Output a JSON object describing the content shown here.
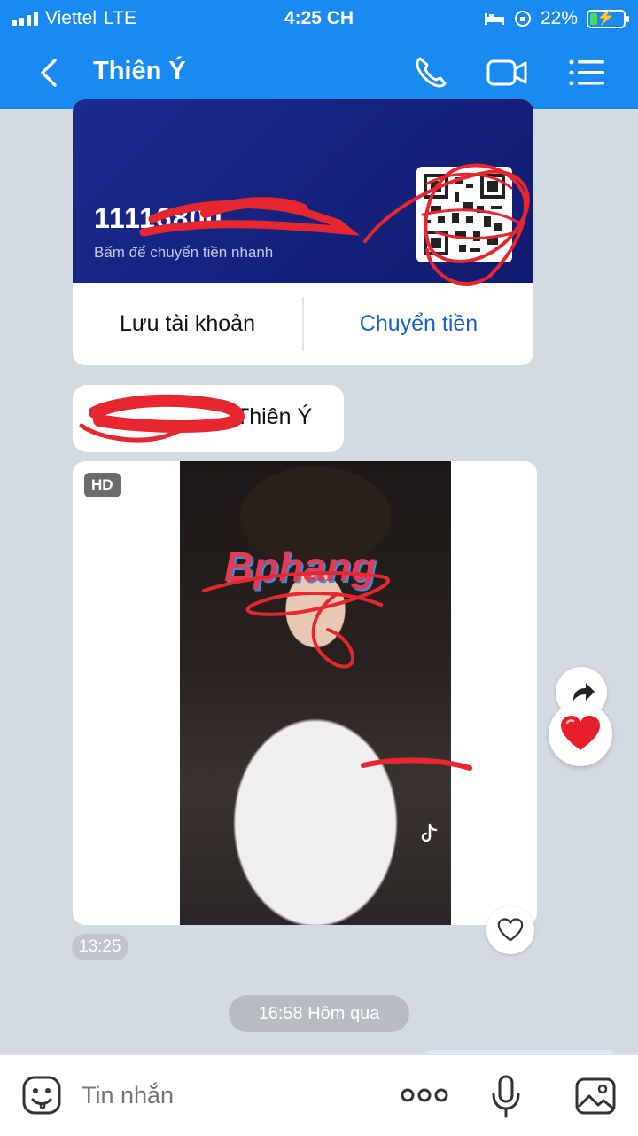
{
  "status_bar": {
    "carrier": "Viettel",
    "network": "LTE",
    "time": "4:25 CH",
    "battery": "22%",
    "battery_level": 0.22
  },
  "header": {
    "contact_name": "Thiên Ý"
  },
  "bank_card": {
    "account_number_visible": "11116800",
    "hint": "Bấm để chuyển tiền nhanh",
    "save_label": "Lưu tài khoản",
    "transfer_label": "Chuyển tiền"
  },
  "name_message": {
    "visible_text": "Thiên Ý"
  },
  "media_message": {
    "quality_badge": "HD",
    "watermark": "Bphang",
    "timestamp": "13:25"
  },
  "date_separator": "16:58 Hôm qua",
  "composer": {
    "placeholder": "Tin nhắn"
  },
  "colors": {
    "header_blue": "#1a8af2",
    "bank_navy": "#14207a",
    "link_blue": "#1a62c9",
    "redaction_red": "#e8262f"
  },
  "icons": [
    "back-icon",
    "phone-icon",
    "video-call-icon",
    "menu-icon",
    "share-icon",
    "heart-icon",
    "like-icon",
    "sticker-icon",
    "more-icon",
    "mic-icon",
    "gallery-icon"
  ]
}
